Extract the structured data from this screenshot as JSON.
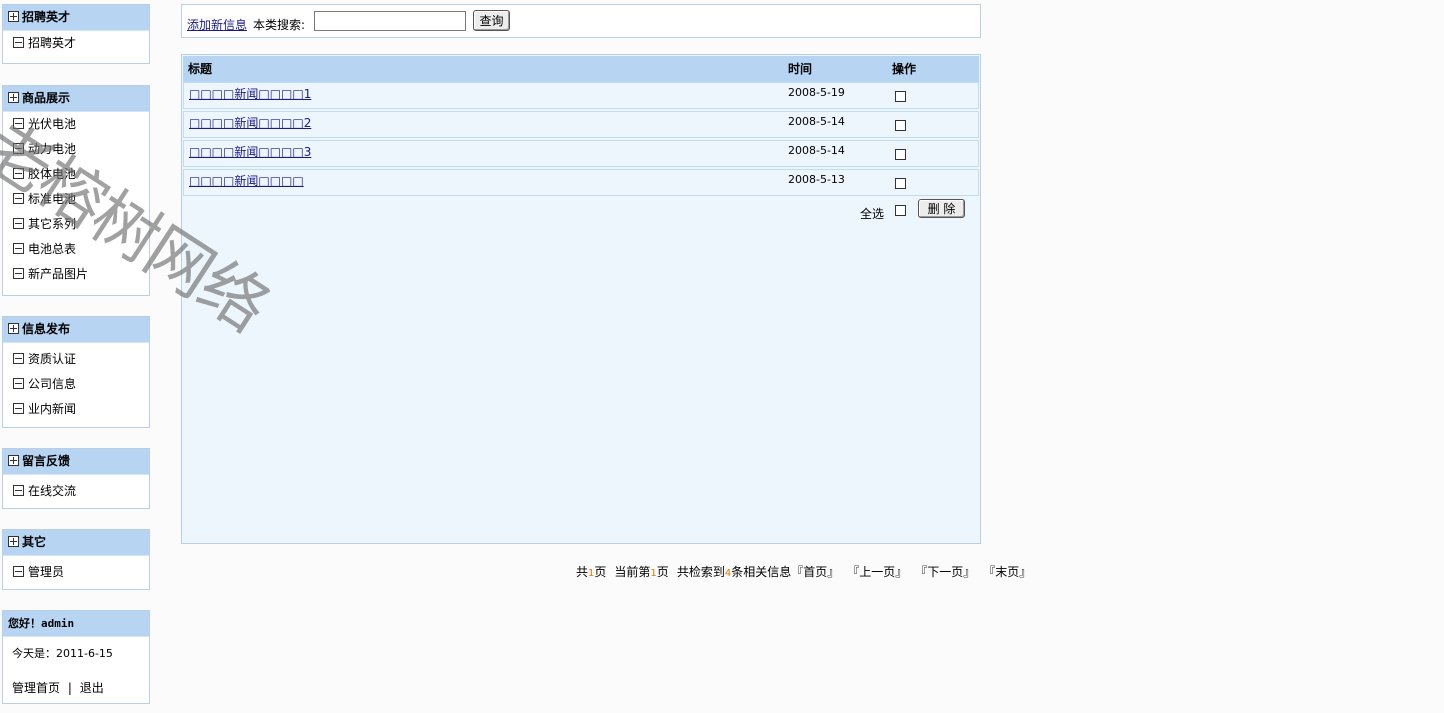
{
  "sidebar": {
    "sections": [
      {
        "title": "招聘英才",
        "items": [
          "招聘英才"
        ]
      },
      {
        "title": "商品展示",
        "items": [
          "光伏电池",
          "动力电池",
          "胶体电池",
          "标准电池",
          "其它系列",
          "电池总表",
          "新产品图片"
        ]
      },
      {
        "title": "信息发布",
        "items": [
          "资质认证",
          "公司信息",
          "业内新闻"
        ]
      },
      {
        "title": "留言反馈",
        "items": [
          "在线交流"
        ]
      },
      {
        "title": "其它",
        "items": [
          "管理员"
        ]
      }
    ],
    "user": {
      "greeting": "您好！admin",
      "date_line": "今天是：2011-6-15",
      "admin_home": "管理首页",
      "separator": "|",
      "logout": "退出"
    }
  },
  "toolbar": {
    "add_link": "添加新信息",
    "search_label": "本类搜索:",
    "search_value": "",
    "query_button": "查询"
  },
  "list": {
    "columns": {
      "title": "标题",
      "time": "时间",
      "operation": "操作"
    },
    "rows": [
      {
        "title": "□□□□新闻□□□□1",
        "date": "2008-5-19"
      },
      {
        "title": "□□□□新闻□□□□2",
        "date": "2008-5-14"
      },
      {
        "title": "□□□□新闻□□□□3",
        "date": "2008-5-14"
      },
      {
        "title": "□□□□新闻□□□□",
        "date": "2008-5-13"
      }
    ],
    "select_all": "全选",
    "delete_button": "删 除"
  },
  "pager": {
    "total_prefix": "共",
    "total_pages": "1",
    "total_suffix": "页",
    "current_prefix": "当前第",
    "current_page": "1",
    "current_suffix": "页",
    "found_prefix": "共检索到",
    "found_count": "4",
    "found_suffix": "条相关信息",
    "first": "『首页』",
    "prev": "『上一页』",
    "next": "『下一页』",
    "last": "『末页』"
  },
  "watermark": "老榕树网络",
  "colors": {
    "header_blue": "#b7d4f3",
    "panel_bg": "#eef6fd",
    "border": "#b9cfe4",
    "link": "#1a1a8c",
    "page_number": "#e07b00"
  }
}
